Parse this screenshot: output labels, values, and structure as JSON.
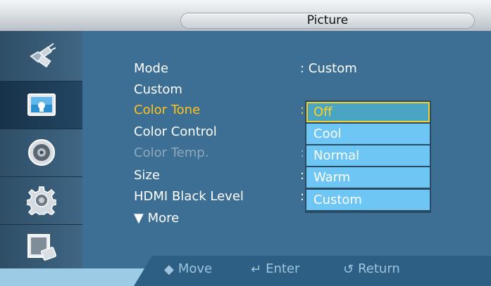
{
  "header": {
    "title": "Picture"
  },
  "rail": {
    "items": [
      {
        "icon": "antenna-plug-icon"
      },
      {
        "icon": "picture-icon",
        "selected": true
      },
      {
        "icon": "speaker-icon"
      },
      {
        "icon": "gear-icon"
      },
      {
        "icon": "remote-icon"
      }
    ]
  },
  "menu": {
    "rows": [
      {
        "label": "Mode",
        "value": ": Custom",
        "state": "normal"
      },
      {
        "label": "Custom",
        "value": "",
        "state": "normal"
      },
      {
        "label": "Color Tone",
        "value": ":",
        "state": "selected"
      },
      {
        "label": "Color Control",
        "value": "",
        "state": "normal"
      },
      {
        "label": "Color Temp.",
        "value": ":",
        "state": "disabled"
      },
      {
        "label": "Size",
        "value": ":",
        "state": "normal"
      },
      {
        "label": "HDMI Black Level",
        "value": ":",
        "state": "normal"
      },
      {
        "label": "▼ More",
        "value": "",
        "state": "normal"
      }
    ]
  },
  "dropdown": {
    "options": [
      "Off",
      "Cool",
      "Normal",
      "Warm",
      "Custom"
    ],
    "selected": "Off"
  },
  "footer": {
    "move": "Move",
    "enter": "Enter",
    "return": "Return"
  },
  "colors": {
    "panel": "#3d6f94",
    "selected_text": "#ffc21a",
    "dropdown_option": "#6ec6f4",
    "disabled_text": "#8fa8bb"
  }
}
